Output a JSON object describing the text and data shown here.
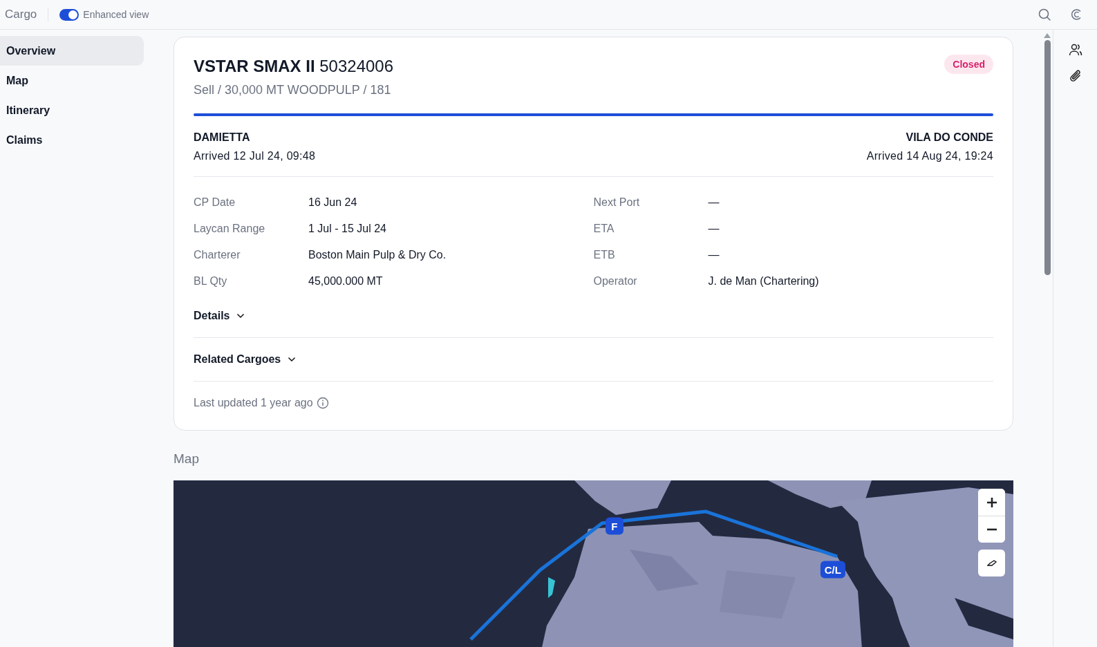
{
  "top_bar": {
    "title": "Cargo",
    "enhanced_view": {
      "label": "Enhanced view",
      "on": true
    }
  },
  "sidebar": {
    "items": [
      {
        "label": "Overview",
        "selected": true
      },
      {
        "label": "Map",
        "selected": false
      },
      {
        "label": "Itinerary",
        "selected": false
      },
      {
        "label": "Claims",
        "selected": false
      }
    ]
  },
  "cargo": {
    "vessel": "VSTAR SMAX II",
    "number": "50324006",
    "subtitle": "Sell / 30,000 MT WOODPULP / 181",
    "status": {
      "label": "Closed",
      "kind": "closed"
    },
    "voyage": {
      "level": 1,
      "from": {
        "port": "DAMIETTA",
        "arrival": "Arrived 12 Jul 24, 09:48"
      },
      "to": {
        "port": "VILA DO CONDE",
        "arrival": "Arrived 14 Aug 24, 19:24"
      }
    },
    "fields_left": [
      {
        "label": "CP Date",
        "value": "16 Jun 24"
      },
      {
        "label": "Laycan Range",
        "value": "1 Jul - 15 Jul 24"
      },
      {
        "label": "Charterer",
        "value": "Boston Main Pulp & Dry Co."
      },
      {
        "label": "BL Qty",
        "value": "45,000.000 MT"
      }
    ],
    "fields_right": [
      {
        "label": "Next Port",
        "value": "—"
      },
      {
        "label": "ETA",
        "value": "—"
      },
      {
        "label": "ETB",
        "value": "—"
      },
      {
        "label": "Operator",
        "value": "J. de Man (Chartering)"
      }
    ],
    "sections": [
      {
        "label": "Details",
        "expanded": false
      },
      {
        "label": "Related Cargoes",
        "expanded": false
      }
    ],
    "last_updated": "Last updated 1 year ago"
  },
  "map": {
    "heading": "Map",
    "kind": "picture",
    "markers": [
      {
        "label": "F"
      },
      {
        "label": "C/L"
      }
    ]
  }
}
